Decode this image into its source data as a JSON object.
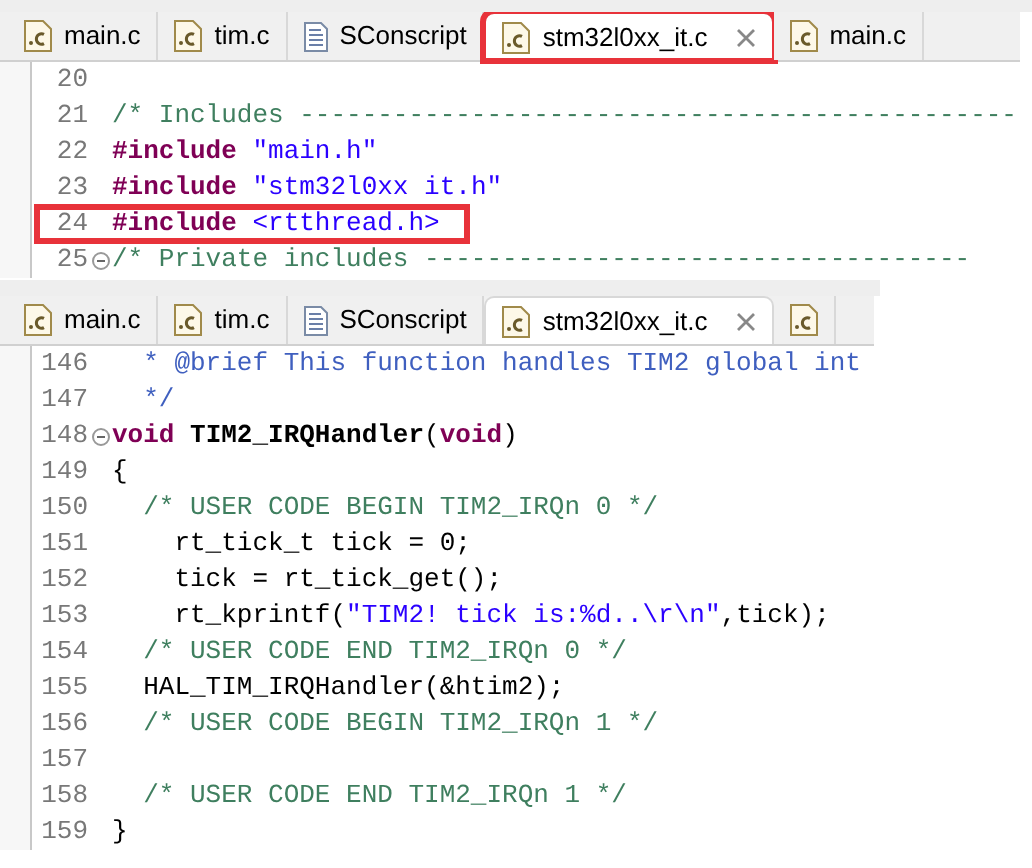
{
  "editors": [
    {
      "tabs": [
        {
          "label": "main.c",
          "kind": "c",
          "selected": false,
          "highlighted": false
        },
        {
          "label": "tim.c",
          "kind": "c",
          "selected": false,
          "highlighted": false
        },
        {
          "label": "SConscript",
          "kind": "text",
          "selected": false,
          "highlighted": false
        },
        {
          "label": "stm32l0xx_it.c",
          "kind": "c",
          "selected": true,
          "highlighted": true
        },
        {
          "label": "main.c",
          "kind": "c",
          "selected": false,
          "highlighted": false
        }
      ],
      "lines": [
        {
          "number": "20",
          "folded": false,
          "highlighted": false
        },
        {
          "number": "21",
          "folded": false,
          "highlighted": false,
          "segments": [
            {
              "kind": "comment",
              "text": "/* Includes ----------------------------------------------"
            }
          ]
        },
        {
          "number": "22",
          "folded": false,
          "highlighted": false,
          "segments": [
            {
              "kind": "keyword",
              "text": "#include"
            },
            {
              "kind": "string",
              "text": " \"main.h\""
            }
          ]
        },
        {
          "number": "23",
          "folded": false,
          "highlighted": false,
          "segments": [
            {
              "kind": "keyword",
              "text": "#include"
            },
            {
              "kind": "string",
              "text": " \"stm32l0xx it.h\""
            }
          ]
        },
        {
          "number": "24",
          "folded": false,
          "highlighted": true,
          "segments": [
            {
              "kind": "keyword",
              "text": "#include"
            },
            {
              "kind": "string",
              "text": " <rtthread.h>"
            }
          ]
        },
        {
          "number": "25",
          "folded": true,
          "highlighted": false,
          "segments": [
            {
              "kind": "comment",
              "text": "/* Private includes -----------------------------------"
            }
          ]
        }
      ]
    },
    {
      "tabs": [
        {
          "label": "main.c",
          "kind": "c",
          "selected": false,
          "highlighted": false
        },
        {
          "label": "tim.c",
          "kind": "c",
          "selected": false,
          "highlighted": false
        },
        {
          "label": "SConscript",
          "kind": "text",
          "selected": false,
          "highlighted": false
        },
        {
          "label": "stm32l0xx_it.c",
          "kind": "c",
          "selected": true,
          "highlighted": false
        },
        {
          "kind": "c",
          "selected": false,
          "highlighted": false
        }
      ],
      "lines": [
        {
          "number": "146",
          "folded": false,
          "highlighted": false,
          "segments": [
            {
              "kind": "doc",
              "text": "  * @brief This function handles TIM2 global int"
            }
          ]
        },
        {
          "number": "147",
          "folded": false,
          "highlighted": false,
          "segments": [
            {
              "kind": "doc",
              "text": "  */"
            }
          ]
        },
        {
          "number": "148",
          "folded": true,
          "highlighted": false,
          "segments": [
            {
              "kind": "keyword",
              "text": "void"
            },
            {
              "kind": "function",
              "text": " TIM2_IRQHandler"
            },
            {
              "kind": "plain",
              "text": "("
            },
            {
              "kind": "keyword",
              "text": "void"
            },
            {
              "kind": "plain",
              "text": ")"
            }
          ]
        },
        {
          "number": "149",
          "folded": false,
          "highlighted": false,
          "segments": [
            {
              "kind": "plain",
              "text": "{"
            }
          ]
        },
        {
          "number": "150",
          "folded": false,
          "highlighted": false,
          "segments": [
            {
              "kind": "comment",
              "text": "  /* USER CODE BEGIN TIM2_IRQn 0 */"
            }
          ]
        },
        {
          "number": "151",
          "folded": false,
          "highlighted": false,
          "segments": [
            {
              "kind": "plain",
              "text": "    rt_tick_t tick = 0;"
            }
          ]
        },
        {
          "number": "152",
          "folded": false,
          "highlighted": false,
          "segments": [
            {
              "kind": "plain",
              "text": "    tick = rt_tick_get();"
            }
          ]
        },
        {
          "number": "153",
          "folded": false,
          "highlighted": false,
          "segments": [
            {
              "kind": "plain",
              "text": "    rt_kprintf("
            },
            {
              "kind": "string",
              "text": "\"TIM2! tick is:%d..\\r\\n\""
            },
            {
              "kind": "plain",
              "text": ",tick);"
            }
          ]
        },
        {
          "number": "154",
          "folded": false,
          "highlighted": false,
          "segments": [
            {
              "kind": "comment",
              "text": "  /* USER CODE END TIM2_IRQn 0 */"
            }
          ]
        },
        {
          "number": "155",
          "folded": false,
          "highlighted": false,
          "segments": [
            {
              "kind": "plain",
              "text": "  HAL_TIM_IRQHandler(&htim2);"
            }
          ]
        },
        {
          "number": "156",
          "folded": false,
          "highlighted": false,
          "segments": [
            {
              "kind": "comment",
              "text": "  /* USER CODE BEGIN TIM2_IRQn 1 */"
            }
          ]
        },
        {
          "number": "157",
          "folded": false,
          "highlighted": false
        },
        {
          "number": "158",
          "folded": false,
          "highlighted": false,
          "segments": [
            {
              "kind": "comment",
              "text": "  /* USER CODE END TIM2_IRQn 1 */"
            }
          ]
        },
        {
          "number": "159",
          "folded": false,
          "highlighted": false,
          "segments": [
            {
              "kind": "plain",
              "text": "}"
            }
          ]
        }
      ]
    }
  ]
}
